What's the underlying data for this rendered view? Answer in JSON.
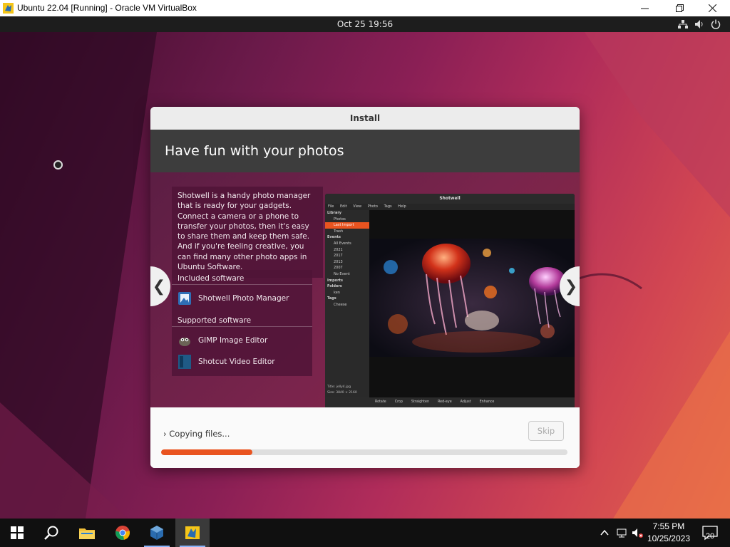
{
  "vbox_window": {
    "title": "Ubuntu 22.04 [Running] - Oracle VM VirtualBox",
    "minimize_icon": "minimize-icon",
    "maximize_icon": "restore-icon",
    "close_icon": "close-icon"
  },
  "ubuntu_topbar": {
    "clock": "Oct 25  19:56",
    "icons": [
      "network-icon",
      "volume-icon",
      "power-icon"
    ]
  },
  "installer": {
    "window_title": "Install",
    "heading": "Have fun with your photos",
    "description": "Shotwell is a handy photo manager that is ready for your gadgets. Connect a camera or a phone to transfer your photos, then it's easy to share them and keep them safe. And if you're feeling creative, you can find many other photo apps in Ubuntu Software.",
    "included_title": "Included software",
    "included": [
      {
        "name": "Shotwell Photo Manager",
        "icon": "shotwell-icon"
      }
    ],
    "supported_title": "Supported software",
    "supported": [
      {
        "name": "GIMP Image Editor",
        "icon": "gimp-icon"
      },
      {
        "name": "Shotcut Video Editor",
        "icon": "shotcut-icon"
      }
    ],
    "prev_arrow": "❮",
    "next_arrow": "❯",
    "status_label": "Copying files...",
    "status_chevron": "›",
    "skip_label": "Skip",
    "progress_fraction": 0.225,
    "accent_color": "#e95420"
  },
  "shotwell_preview": {
    "title": "Shotwell",
    "menu": [
      "File",
      "Edit",
      "View",
      "Photo",
      "Tags",
      "Help"
    ],
    "sidebar": [
      {
        "label": "Library",
        "kind": "head"
      },
      {
        "label": "Photos",
        "kind": "item"
      },
      {
        "label": "Last Import",
        "kind": "sel"
      },
      {
        "label": "Trash",
        "kind": "item"
      },
      {
        "label": "Events",
        "kind": "head"
      },
      {
        "label": "All Events",
        "kind": "item"
      },
      {
        "label": "2021",
        "kind": "item"
      },
      {
        "label": "2017",
        "kind": "item"
      },
      {
        "label": "2013",
        "kind": "item"
      },
      {
        "label": "2007",
        "kind": "item"
      },
      {
        "label": "No Event",
        "kind": "item"
      },
      {
        "label": "Imports",
        "kind": "head"
      },
      {
        "label": "Folders",
        "kind": "head"
      },
      {
        "label": "ken",
        "kind": "item"
      },
      {
        "label": "Tags",
        "kind": "head"
      },
      {
        "label": "Cheese",
        "kind": "item"
      }
    ],
    "meta_title_label": "Title:",
    "meta_title": "jelly4.jpg",
    "meta_size_label": "Size:",
    "meta_size": "3840 × 2160",
    "toolbar": [
      "Rotate",
      "Crop",
      "Straighten",
      "Red-eye",
      "Adjust",
      "Enhance"
    ]
  },
  "taskbar": {
    "apps": [
      "windows-start-icon",
      "search-icon",
      "file-explorer-icon",
      "chrome-icon",
      "virtualbox-icon",
      "virtualbox-vm-icon"
    ],
    "time": "7:55 PM",
    "date": "10/25/2023",
    "notification_count": "20"
  }
}
